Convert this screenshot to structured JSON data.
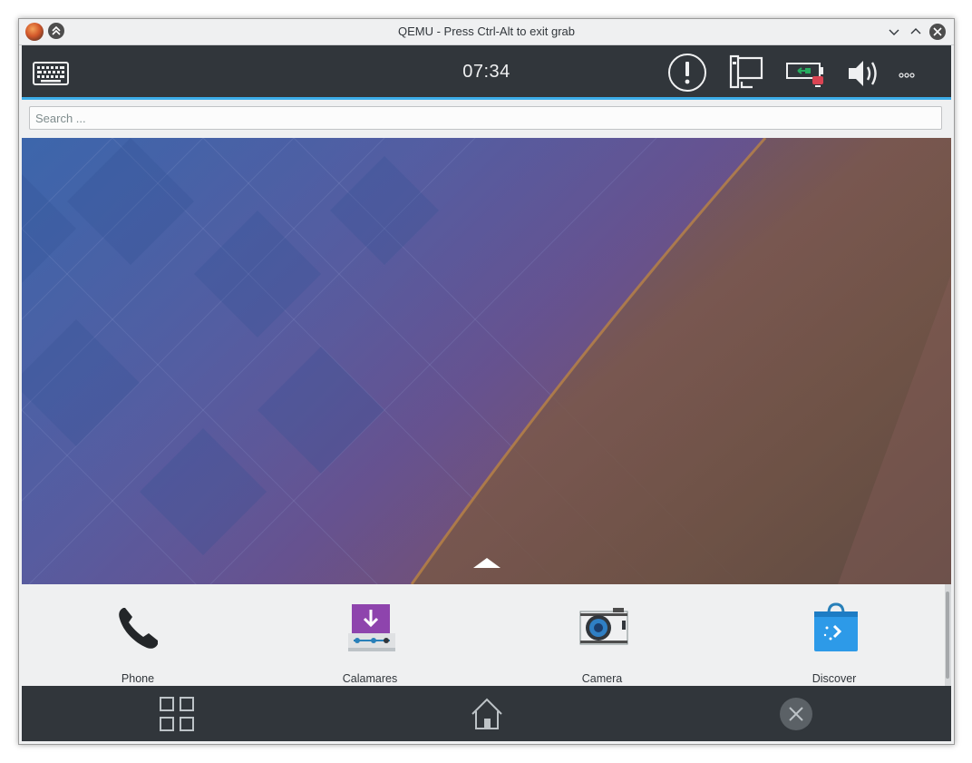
{
  "window": {
    "title": "QEMU - Press Ctrl-Alt to exit grab"
  },
  "top_panel": {
    "clock": "07:34",
    "icons": [
      "keyboard-icon",
      "notification-alert-icon",
      "network-icon",
      "battery-icon",
      "volume-icon",
      "overflow-menu-icon"
    ]
  },
  "search": {
    "placeholder": "Search ...",
    "value": ""
  },
  "favorites": [
    {
      "label": "Phone",
      "icon": "phone-icon"
    },
    {
      "label": "Calamares",
      "icon": "calamares-installer-icon"
    },
    {
      "label": "Camera",
      "icon": "camera-icon"
    },
    {
      "label": "Discover",
      "icon": "discover-store-icon"
    }
  ],
  "bottom_panel": {
    "buttons": [
      "task-switcher-button",
      "home-button",
      "close-window-button"
    ]
  },
  "colors": {
    "panel": "#31363b",
    "accent": "#3daee9",
    "background": "#eff0f1",
    "text_light": "#eff0f1",
    "text_dark": "#31363b"
  }
}
